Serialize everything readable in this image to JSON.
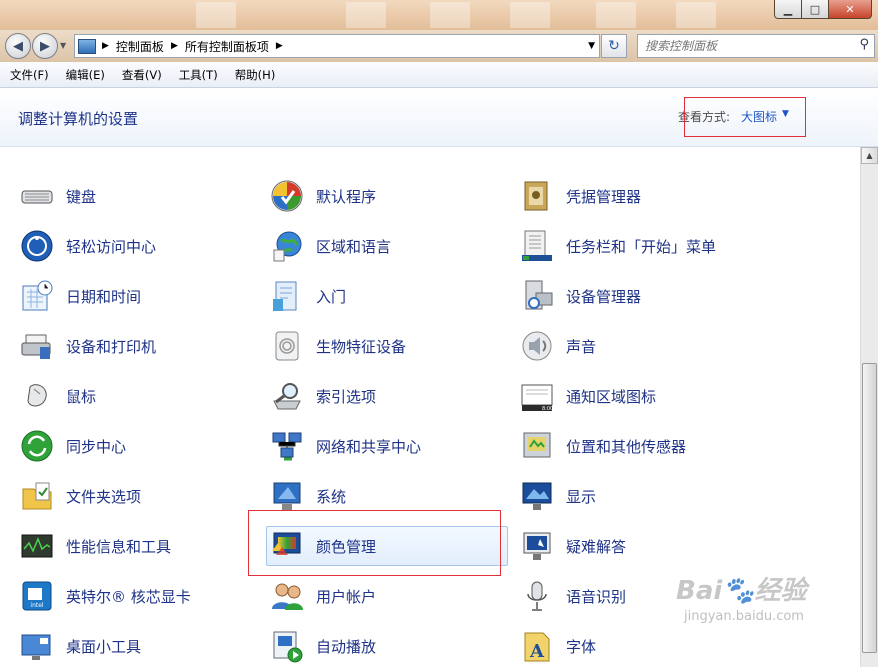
{
  "window": {
    "min_glyph": "▁",
    "max_glyph": "□",
    "close_glyph": "✕"
  },
  "nav": {
    "back_glyph": "◀",
    "forward_glyph": "▶",
    "recent_glyph": "▼",
    "refresh_glyph": "↻"
  },
  "address": {
    "sep_glyph": "▶",
    "crumbs": [
      "控制面板",
      "所有控制面板项"
    ],
    "dropdown_glyph": "▼"
  },
  "search": {
    "placeholder": "搜索控制面板",
    "icon_glyph": "⚲"
  },
  "menu": [
    "文件(F)",
    "编辑(E)",
    "查看(V)",
    "工具(T)",
    "帮助(H)"
  ],
  "header": {
    "title": "调整计算机的设置",
    "view_by_label": "查看方式:",
    "view_by_value": "大图标",
    "view_by_arrow": "▼"
  },
  "items": {
    "col1": [
      "",
      "键盘",
      "轻松访问中心",
      "日期和时间",
      "设备和打印机",
      "鼠标",
      "同步中心",
      "文件夹选项",
      "性能信息和工具",
      "英特尔® 核芯显卡",
      "桌面小工具"
    ],
    "col2": [
      "",
      "默认程序",
      "区域和语言",
      "入门",
      "生物特征设备",
      "索引选项",
      "网络和共享中心",
      "系统",
      "颜色管理",
      "用户帐户",
      "自动播放"
    ],
    "col3": [
      "",
      "凭据管理器",
      "任务栏和「开始」菜单",
      "设备管理器",
      "声音",
      "通知区域图标",
      "位置和其他传感器",
      "显示",
      "疑难解答",
      "语音识别",
      "字体"
    ]
  },
  "icons": {
    "col1": [
      "admin-tools-icon",
      "keyboard-icon",
      "ease-of-access-icon",
      "date-time-icon",
      "devices-printers-icon",
      "mouse-icon",
      "sync-center-icon",
      "folder-options-icon",
      "performance-icon",
      "intel-graphics-icon",
      "gadgets-icon"
    ],
    "col2": [
      "backup-icon",
      "default-programs-icon",
      "region-language-icon",
      "getting-started-icon",
      "biometric-icon",
      "indexing-icon",
      "network-sharing-icon",
      "system-icon",
      "color-management-icon",
      "user-accounts-icon",
      "autoplay-icon"
    ],
    "col3": [
      "homegroup-icon",
      "credential-manager-icon",
      "taskbar-icon",
      "device-manager-icon",
      "sound-icon",
      "notification-icons-icon",
      "location-sensors-icon",
      "display-icon",
      "troubleshooting-icon",
      "speech-recognition-icon",
      "fonts-icon"
    ]
  },
  "highlighted_item": "颜色管理",
  "scroll_up_glyph": "▲",
  "watermark": {
    "logo_text": "Bai🐾经验",
    "url": "jingyan.baidu.com"
  },
  "colors": {
    "link_blue": "#1e3287",
    "title_blue": "#1e3287",
    "annotation_red": "#e0303a",
    "view_value_blue": "#1e55c4"
  }
}
